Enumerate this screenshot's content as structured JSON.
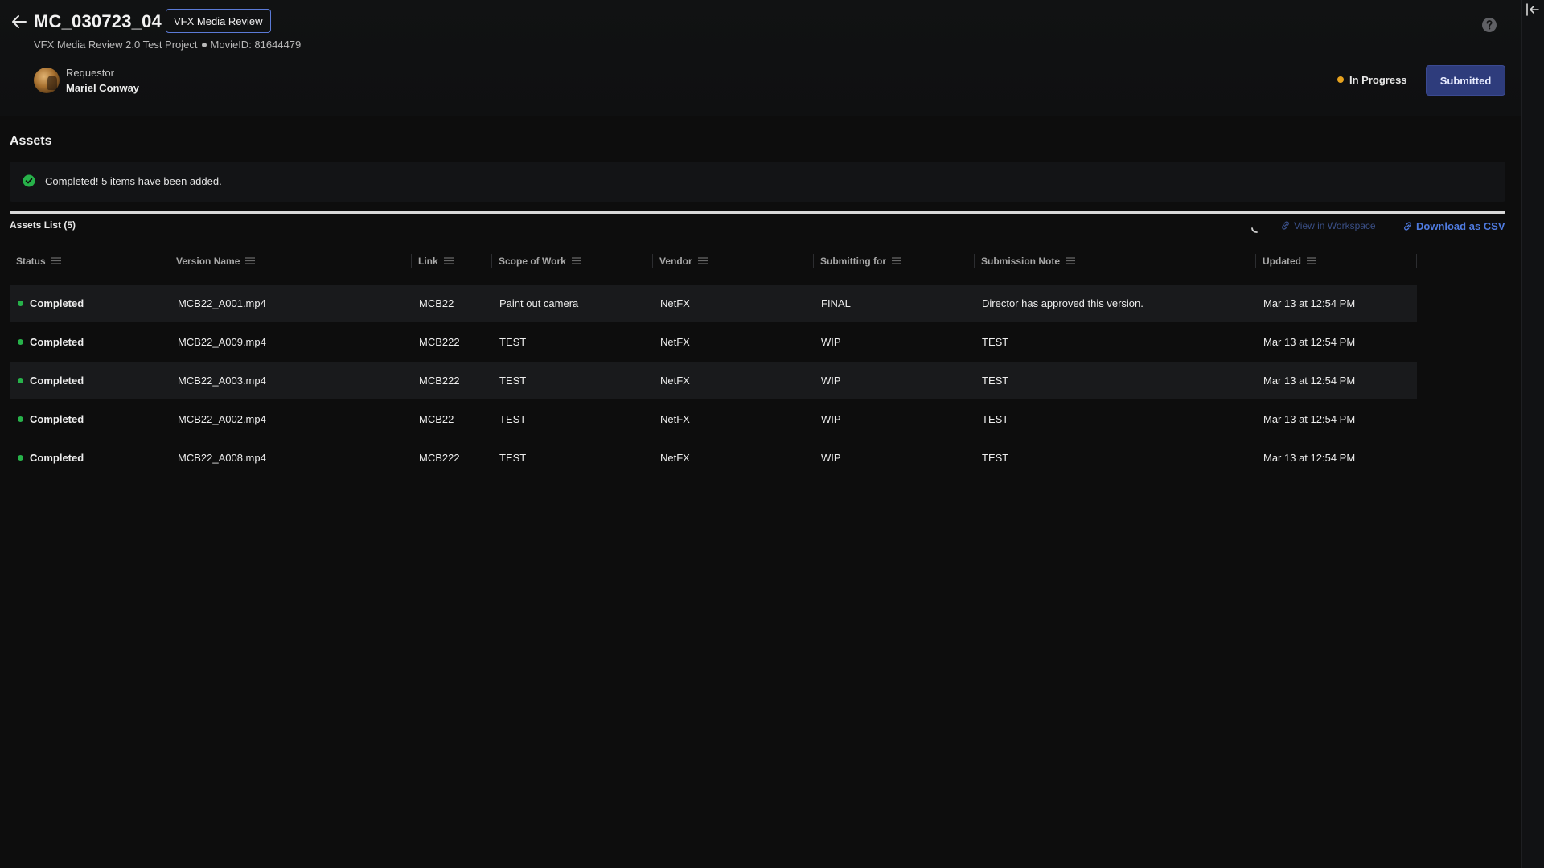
{
  "header": {
    "title": "MC_030723_04",
    "project_tag": "VFX Media Review",
    "project_name": "VFX Media Review 2.0 Test Project",
    "movie_id": "MovieID: 81644479",
    "requestor_label": "Requestor",
    "requestor_name": "Mariel Conway",
    "status_text": "In Progress",
    "submitted_label": "Submitted"
  },
  "assets": {
    "section_title": "Assets",
    "notice_text": "Completed! 5 items have been added.",
    "progress_percent": 100,
    "list_title": "Assets List (5)",
    "view_workspace_label": "View in Workspace",
    "download_csv_label": "Download as CSV"
  },
  "table": {
    "columns": [
      "Status",
      "Version Name",
      "Link",
      "Scope of Work",
      "Vendor",
      "Submitting for",
      "Submission Note",
      "Updated"
    ],
    "rows": [
      {
        "status": "Completed",
        "version": "MCB22_A001.mp4",
        "link": "MCB22",
        "scope": "Paint out camera",
        "vendor": "NetFX",
        "submitting_for": "FINAL",
        "note": "Director has approved this version.",
        "updated": "Mar 13 at 12:54 PM"
      },
      {
        "status": "Completed",
        "version": "MCB22_A009.mp4",
        "link": "MCB222",
        "scope": "TEST",
        "vendor": "NetFX",
        "submitting_for": "WIP",
        "note": "TEST",
        "updated": "Mar 13 at 12:54 PM"
      },
      {
        "status": "Completed",
        "version": "MCB22_A003.mp4",
        "link": "MCB222",
        "scope": "TEST",
        "vendor": "NetFX",
        "submitting_for": "WIP",
        "note": "TEST",
        "updated": "Mar 13 at 12:54 PM"
      },
      {
        "status": "Completed",
        "version": "MCB22_A002.mp4",
        "link": "MCB22",
        "scope": "TEST",
        "vendor": "NetFX",
        "submitting_for": "WIP",
        "note": "TEST",
        "updated": "Mar 13 at 12:54 PM"
      },
      {
        "status": "Completed",
        "version": "MCB22_A008.mp4",
        "link": "MCB222",
        "scope": "TEST",
        "vendor": "NetFX",
        "submitting_for": "WIP",
        "note": "TEST",
        "updated": "Mar 13 at 12:54 PM"
      }
    ]
  },
  "icons": {
    "back": "arrow-left-icon",
    "help": "question-circle-icon",
    "check": "check-circle-icon",
    "spinner": "spinner-icon",
    "link": "link-icon",
    "column_menu": "menu-lines-icon",
    "collapse": "collapse-panel-icon"
  },
  "colors": {
    "accent": "#4f7be0",
    "status_in_progress": "#e6a21e",
    "status_completed": "#27b24a",
    "submitted_button": "#2e3c7c"
  }
}
